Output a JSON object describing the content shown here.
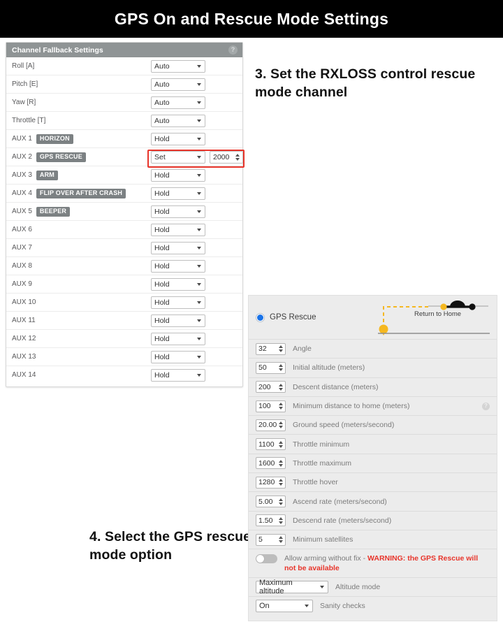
{
  "header": {
    "title": "GPS On and Rescue Mode Settings"
  },
  "fallback_panel": {
    "title": "Channel Fallback Settings",
    "help_icon": "question-mark-icon",
    "highlight_color": "#e8342a",
    "rows": [
      {
        "label": "Roll [A]",
        "badge": "",
        "mode": "Auto",
        "value": ""
      },
      {
        "label": "Pitch [E]",
        "badge": "",
        "mode": "Auto",
        "value": ""
      },
      {
        "label": "Yaw [R]",
        "badge": "",
        "mode": "Auto",
        "value": ""
      },
      {
        "label": "Throttle [T]",
        "badge": "",
        "mode": "Auto",
        "value": ""
      },
      {
        "label": "AUX 1",
        "badge": "HORIZON",
        "mode": "Hold",
        "value": ""
      },
      {
        "label": "AUX 2",
        "badge": "GPS RESCUE",
        "mode": "Set",
        "value": "2000"
      },
      {
        "label": "AUX 3",
        "badge": "ARM",
        "mode": "Hold",
        "value": ""
      },
      {
        "label": "AUX 4",
        "badge": "FLIP OVER AFTER CRASH",
        "mode": "Hold",
        "value": ""
      },
      {
        "label": "AUX 5",
        "badge": "BEEPER",
        "mode": "Hold",
        "value": ""
      },
      {
        "label": "AUX 6",
        "badge": "",
        "mode": "Hold",
        "value": ""
      },
      {
        "label": "AUX 7",
        "badge": "",
        "mode": "Hold",
        "value": ""
      },
      {
        "label": "AUX 8",
        "badge": "",
        "mode": "Hold",
        "value": ""
      },
      {
        "label": "AUX 9",
        "badge": "",
        "mode": "Hold",
        "value": ""
      },
      {
        "label": "AUX 10",
        "badge": "",
        "mode": "Hold",
        "value": ""
      },
      {
        "label": "AUX 11",
        "badge": "",
        "mode": "Hold",
        "value": ""
      },
      {
        "label": "AUX 12",
        "badge": "",
        "mode": "Hold",
        "value": ""
      },
      {
        "label": "AUX 13",
        "badge": "",
        "mode": "Hold",
        "value": ""
      },
      {
        "label": "AUX 14",
        "badge": "",
        "mode": "Hold",
        "value": ""
      }
    ]
  },
  "annotations": {
    "step3": "3. Set the RXLOSS control rescue mode channel",
    "step4": "4. Select the GPS rescue mode option"
  },
  "gps_panel": {
    "radio_label": "GPS Rescue",
    "radio_selected": true,
    "radio_color": "#1a73e8",
    "illustration": {
      "caption": "Return to Home",
      "path_color": "#f5b820",
      "drone_color": "#111111"
    },
    "numeric_rows": [
      {
        "value": "32",
        "label": "Angle",
        "help": false
      },
      {
        "value": "50",
        "label": "Initial altitude (meters)",
        "help": false
      },
      {
        "value": "200",
        "label": "Descent distance (meters)",
        "help": false
      },
      {
        "value": "100",
        "label": "Minimum distance to home (meters)",
        "help": true
      },
      {
        "value": "20.00",
        "label": "Ground speed (meters/second)",
        "help": false
      },
      {
        "value": "1100",
        "label": "Throttle minimum",
        "help": false
      },
      {
        "value": "1600",
        "label": "Throttle maximum",
        "help": false
      },
      {
        "value": "1280",
        "label": "Throttle hover",
        "help": false
      },
      {
        "value": "5.00",
        "label": "Ascend rate (meters/second)",
        "help": false
      },
      {
        "value": "1.50",
        "label": "Descend rate (meters/second)",
        "help": false
      },
      {
        "value": "5",
        "label": "Minimum satellites",
        "help": false
      }
    ],
    "toggle_row": {
      "enabled": false,
      "text_plain": "Allow arming without fix - ",
      "text_warning": "WARNING: the GPS Rescue will not be available",
      "warning_color": "#e8342a"
    },
    "select_rows": [
      {
        "value": "Maximum altitude",
        "label": "Altitude mode"
      },
      {
        "value": "On",
        "label": "Sanity checks"
      }
    ]
  }
}
